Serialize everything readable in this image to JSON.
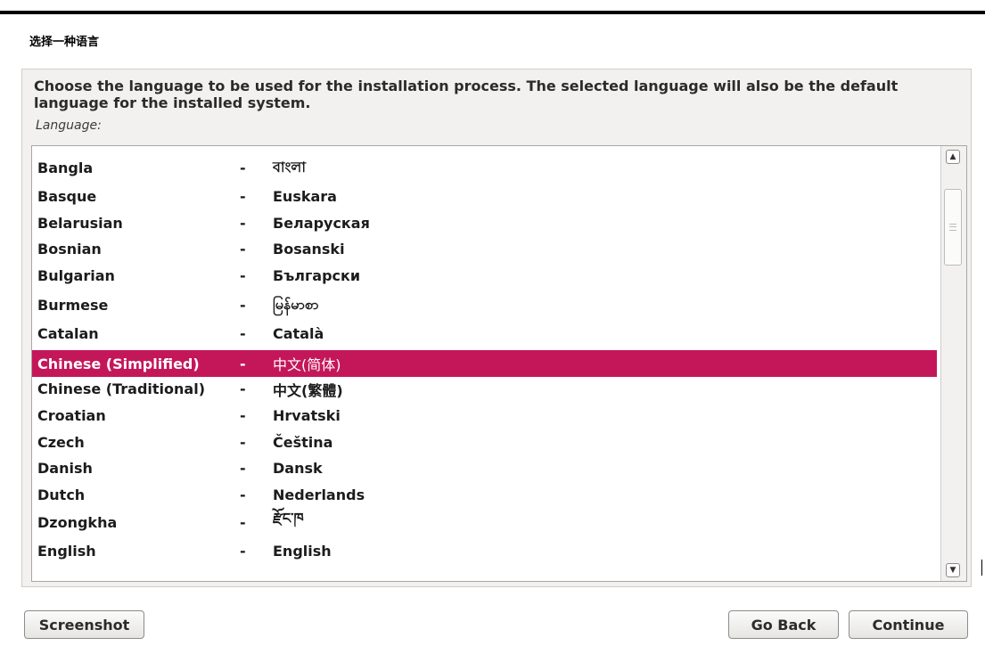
{
  "window": {
    "title": "选择一种语言"
  },
  "prompt": "Choose the language to be used for the installation process. The selected language will also be the default language for the installed system.",
  "field_label": "Language:",
  "languages": [
    {
      "name": "Bangla",
      "native": "বাংলা"
    },
    {
      "name": "Basque",
      "native": "Euskara"
    },
    {
      "name": "Belarusian",
      "native": "Беларуская"
    },
    {
      "name": "Bosnian",
      "native": "Bosanski"
    },
    {
      "name": "Bulgarian",
      "native": "Български"
    },
    {
      "name": "Burmese",
      "native": "မြန်မာစာ"
    },
    {
      "name": "Catalan",
      "native": "Català"
    },
    {
      "name": "Chinese (Simplified)",
      "native": "中文(简体)",
      "selected": true
    },
    {
      "name": "Chinese (Traditional)",
      "native": "中文(繁體)"
    },
    {
      "name": "Croatian",
      "native": "Hrvatski"
    },
    {
      "name": "Czech",
      "native": "Čeština"
    },
    {
      "name": "Danish",
      "native": "Dansk"
    },
    {
      "name": "Dutch",
      "native": "Nederlands"
    },
    {
      "name": "Dzongkha",
      "native": "རྫོང་ཁ"
    },
    {
      "name": "English",
      "native": "English"
    }
  ],
  "separator": "-",
  "buttons": {
    "screenshot": "Screenshot",
    "go_back": "Go Back",
    "continue": "Continue"
  },
  "icons": {
    "scroll_up": "chevron-up-icon",
    "scroll_down": "chevron-down-icon"
  },
  "colors": {
    "selection": "#c4175a",
    "panel": "#f2f1f0"
  }
}
